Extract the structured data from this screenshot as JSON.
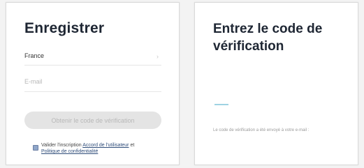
{
  "register": {
    "title": "Enregistrer",
    "country": "France",
    "email_placeholder": "E-mail",
    "get_code_button": "Obtenir le code de vérification",
    "agree_prefix": "Valider l'inscription ",
    "user_agreement": "Accord de l'utilisateur",
    "agree_and": " et ",
    "privacy_policy": "Politique de confidentialité"
  },
  "verify": {
    "title": "Entrez le code de vérification",
    "sent_message": "Le code de vérification a été envoyé à votre e-mail :"
  },
  "colors": {
    "button_disabled_bg": "#e4e4e4",
    "code_underline": "#9fd3e3",
    "link": "#2f4d7a"
  }
}
